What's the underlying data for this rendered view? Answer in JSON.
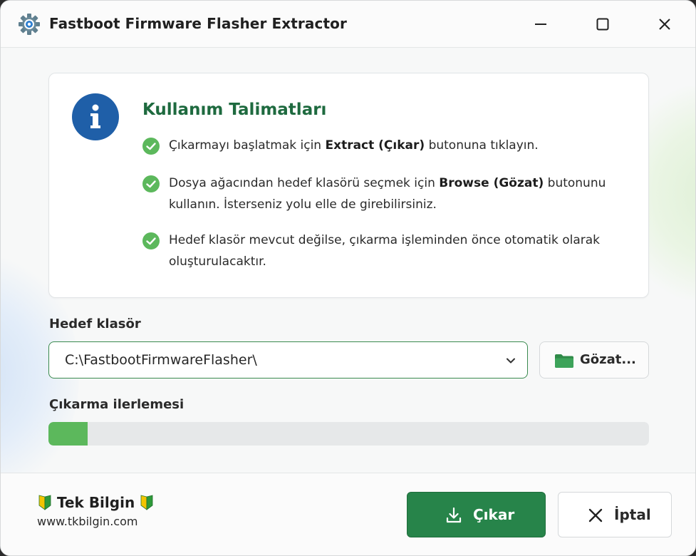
{
  "window": {
    "title": "Fastboot Firmware Flasher Extractor",
    "app_icon": "gear-icon",
    "controls": [
      "minimize-icon",
      "maximize-icon",
      "close-icon"
    ]
  },
  "instructions": {
    "title": "Kullanım Talimatları",
    "icon": "info-icon",
    "items": [
      {
        "before": "Çıkarmayı başlatmak için ",
        "bold": "Extract (Çıkar)",
        "after": " butonuna tıklayın.",
        "icon": "check-circle-icon"
      },
      {
        "before": "Dosya ağacından hedef klasörü seçmek için ",
        "bold": "Browse (Gözat)",
        "after": " butonunu kullanın. İsterseniz yolu elle de girebilirsiniz.",
        "icon": "check-circle-icon"
      },
      {
        "before": "Hedef klasör mevcut değilse, çıkarma işleminden önce otomatik olarak oluşturulacaktır.",
        "bold": "",
        "after": "",
        "icon": "check-circle-icon"
      }
    ]
  },
  "target": {
    "label": "Hedef klasör",
    "value": "C:\\FastbootFirmwareFlasher\\",
    "dropdown_icon": "chevron-down-icon",
    "browse_label": "Gözat...",
    "browse_icon": "folder-icon"
  },
  "progress": {
    "label": "Çıkarma ilerlemesi",
    "fraction": 0.065
  },
  "footer": {
    "brand_name": "Tek Bilgin",
    "brand_icon": "beginner-leaf-icon",
    "brand_url": "www.tkbilgin.com",
    "extract_label": "Çıkar",
    "extract_icon": "download-icon",
    "cancel_label": "İptal",
    "cancel_icon": "close-icon"
  },
  "colors": {
    "accent_green": "#27844a",
    "title_green": "#1e6a3f",
    "info_blue": "#1f5fa8",
    "check_green": "#5cb85c",
    "progress_fill": "#5cb85c"
  }
}
